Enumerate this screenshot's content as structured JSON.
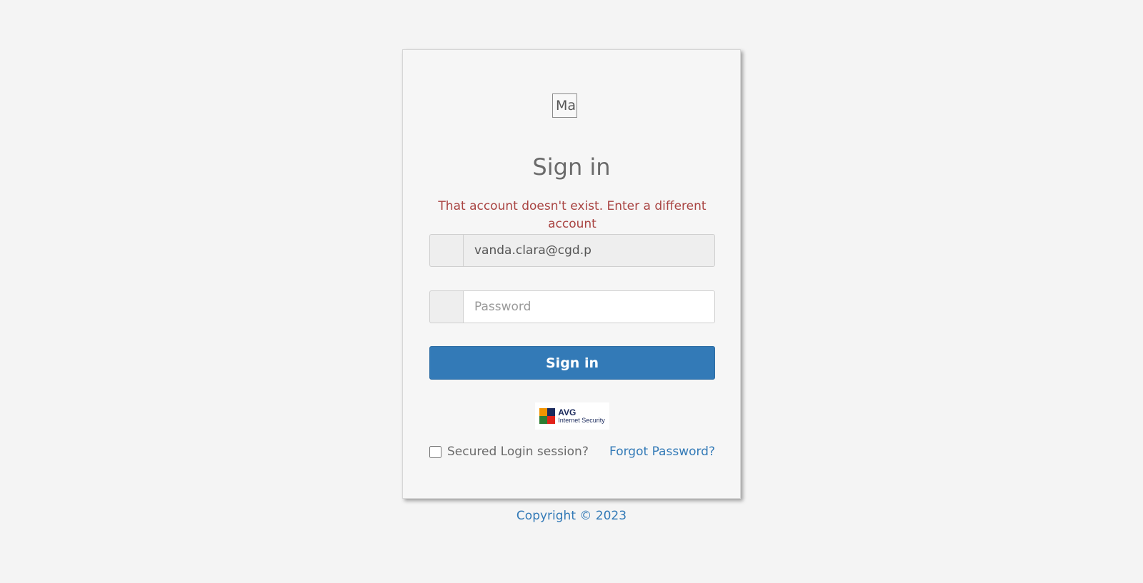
{
  "logo": {
    "alt_text": "Ma"
  },
  "form": {
    "title": "Sign in",
    "error_message": "That account doesn't exist. Enter a different account",
    "email_value": "vanda.clara@cgd.p",
    "password_placeholder": "Password",
    "submit_label": "Sign in",
    "secured_label": "Secured Login session?",
    "forgot_label": "Forgot Password?"
  },
  "badge": {
    "name": "AVG",
    "subtitle": "Internet Security"
  },
  "footer": {
    "copyright": "Copyright © 2023"
  },
  "colors": {
    "primary": "#337ab7",
    "error": "#a94442",
    "background": "#f4f4f4"
  },
  "icons": {
    "badge_mark": "avg-logo-icon"
  }
}
